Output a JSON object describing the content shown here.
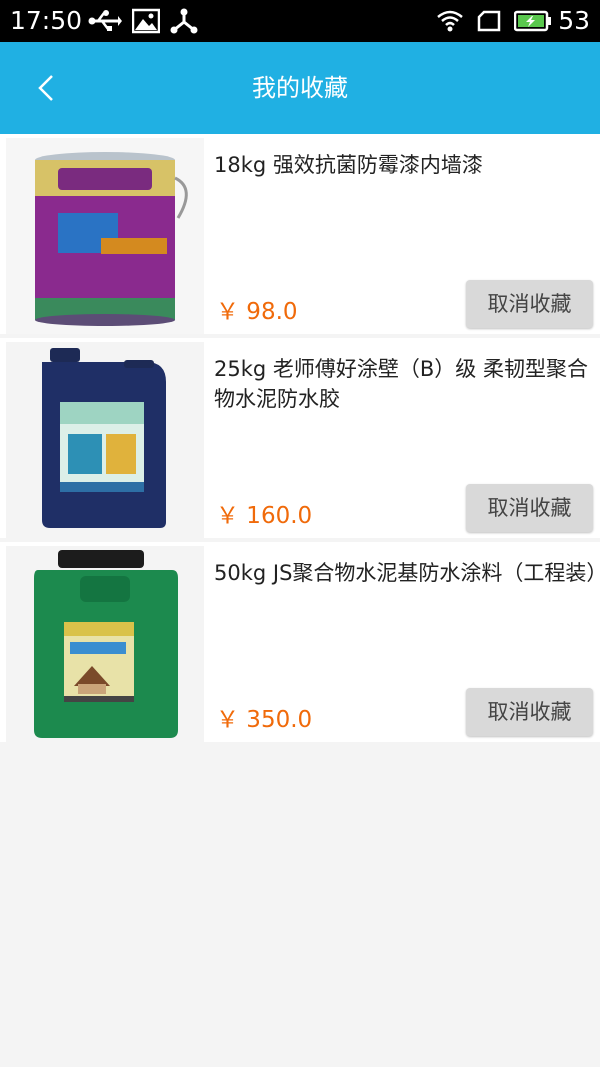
{
  "status_bar": {
    "time": "17:50",
    "battery_level": "53",
    "icons": [
      "usb-icon",
      "image-icon",
      "share-node-icon",
      "wifi-icon",
      "signal-box-icon",
      "battery-charging-icon"
    ]
  },
  "header": {
    "title": "我的收藏",
    "back_icon": "chevron-left-icon",
    "color": "#20b0e3"
  },
  "favorites": [
    {
      "title": "18kg 强效抗菌防霉漆内墙漆",
      "price": "￥ 98.0",
      "action_label": "取消收藏"
    },
    {
      "title": "25kg 老师傅好涂壁（B）级 柔韧型聚合物水泥防水胶",
      "price": "￥ 160.0",
      "action_label": "取消收藏"
    },
    {
      "title": "50kg JS聚合物水泥基防水涂料（工程装）",
      "price": "￥ 350.0",
      "action_label": "取消收藏"
    }
  ],
  "colors": {
    "price": "#f06a0a",
    "button_bg": "#d9d9d9"
  }
}
